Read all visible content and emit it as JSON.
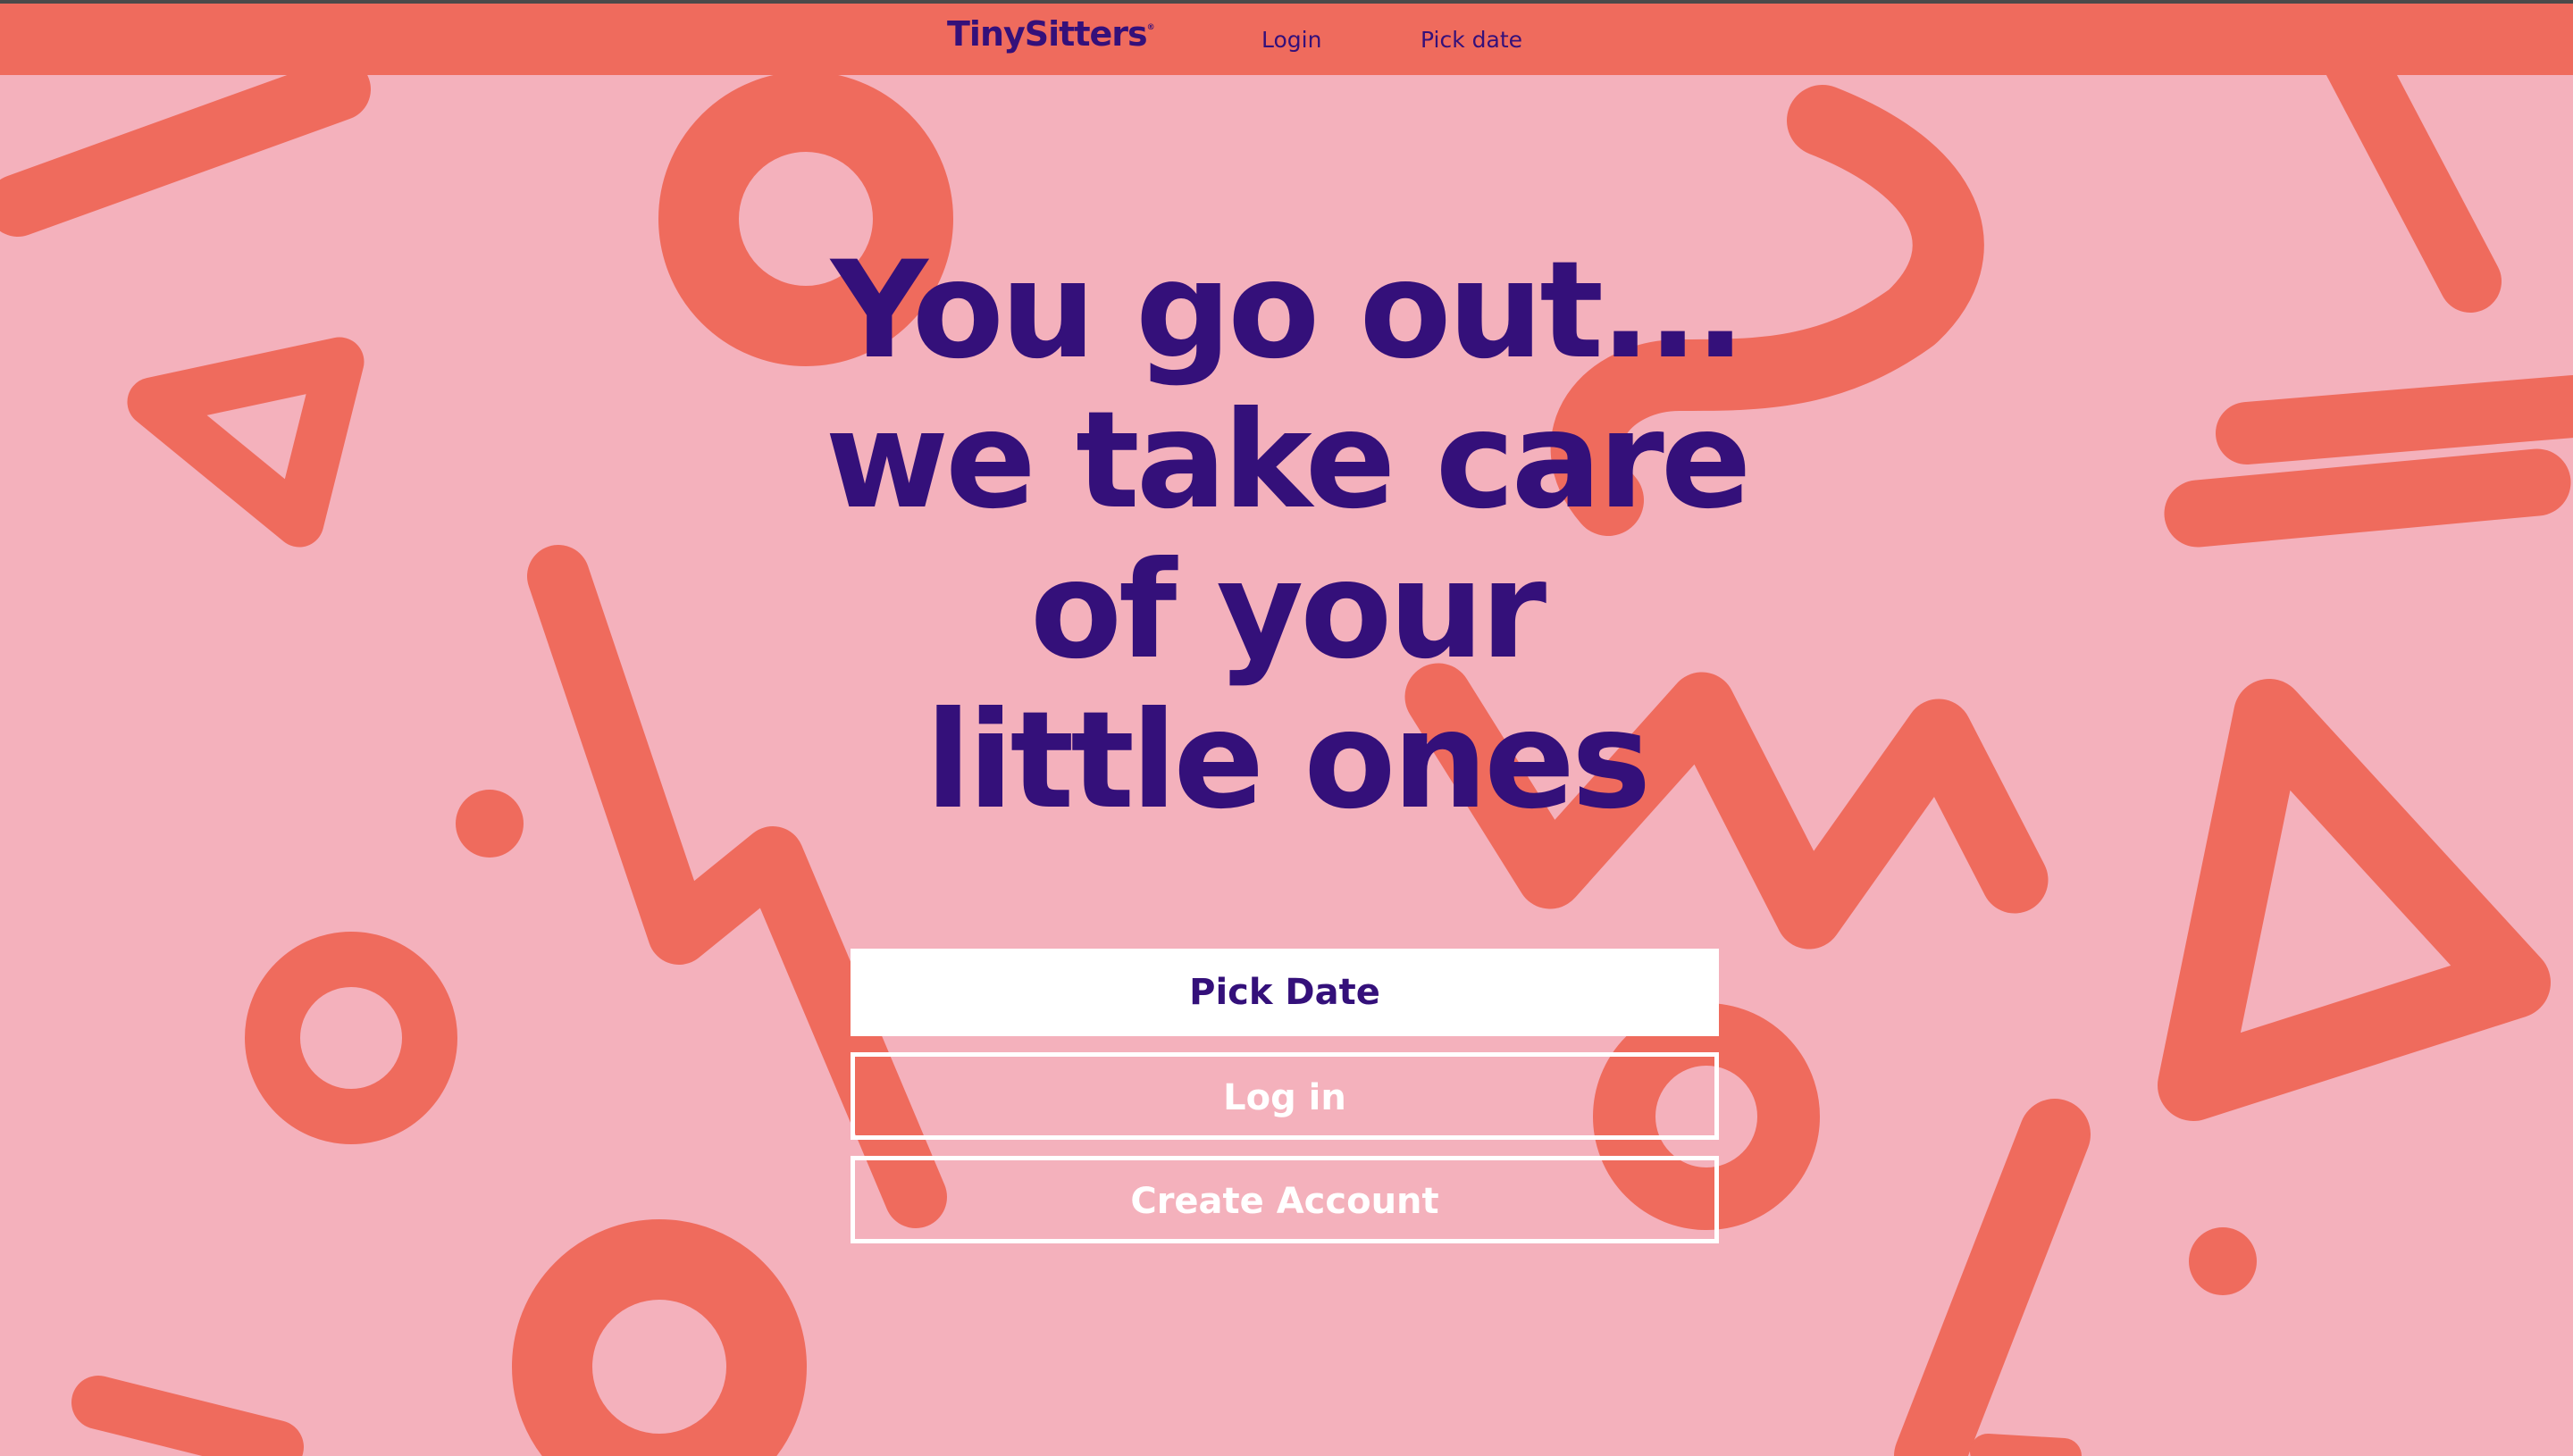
{
  "nav": {
    "brand": "TinySitters",
    "brand_mark": "®",
    "login_link": "Login",
    "pick_date_link": "Pick date"
  },
  "hero": {
    "lines": [
      "You go out...",
      "we take care",
      "of your",
      "little ones"
    ]
  },
  "actions": {
    "pick_date": "Pick Date",
    "log_in": "Log in",
    "create_account": "Create Account"
  },
  "colors": {
    "background": "#f4b1bc",
    "accent": "#ef6b5d",
    "text_primary": "#34107a",
    "button_fill": "#ffffff"
  }
}
